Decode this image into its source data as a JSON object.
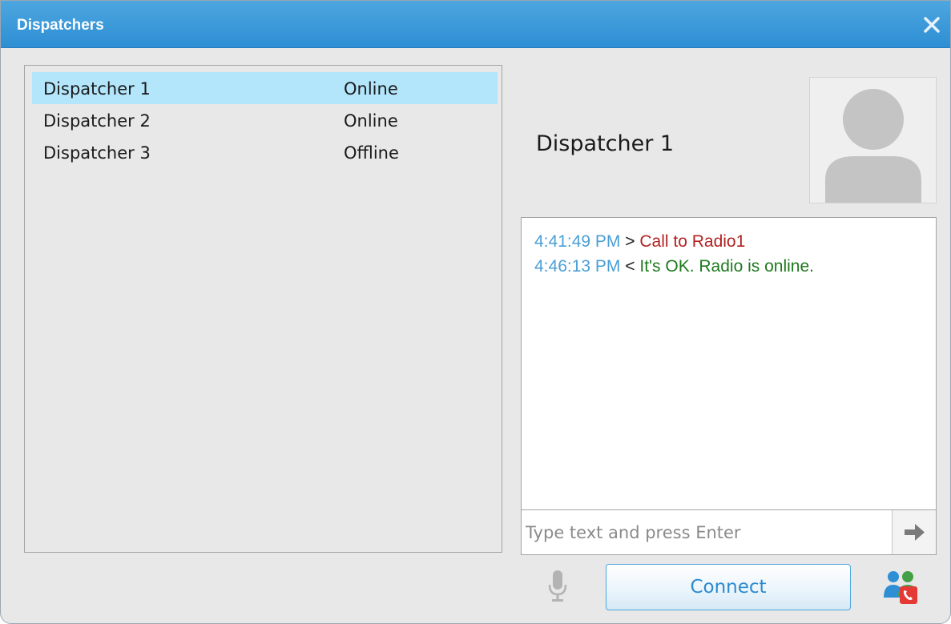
{
  "window": {
    "title": "Dispatchers"
  },
  "dispatchers": [
    {
      "name": "Dispatcher 1",
      "status": "Online",
      "selected": true
    },
    {
      "name": "Dispatcher 2",
      "status": "Online",
      "selected": false
    },
    {
      "name": "Dispatcher 3",
      "status": "Offline",
      "selected": false
    }
  ],
  "contact": {
    "name": "Dispatcher 1",
    "avatar_icon": "user-silhouette-icon"
  },
  "chat": {
    "messages": [
      {
        "time": "4:41:49 PM",
        "direction": ">",
        "text": "Call to Radio1",
        "color": "#b22222"
      },
      {
        "time": "4:46:13 PM",
        "direction": "<",
        "text": "It's OK. Radio is online.",
        "color": "#1e7a1e"
      }
    ],
    "input_placeholder": "Type text and press Enter",
    "input_value": ""
  },
  "footer": {
    "connect_label": "Connect",
    "mic_icon": "microphone-icon",
    "group_call_icon": "group-call-icon"
  },
  "colors": {
    "titlebar": "#3a9bd9",
    "selection": "#b3e5fb",
    "time": "#4a9fd6",
    "accent": "#2b8ad0"
  }
}
